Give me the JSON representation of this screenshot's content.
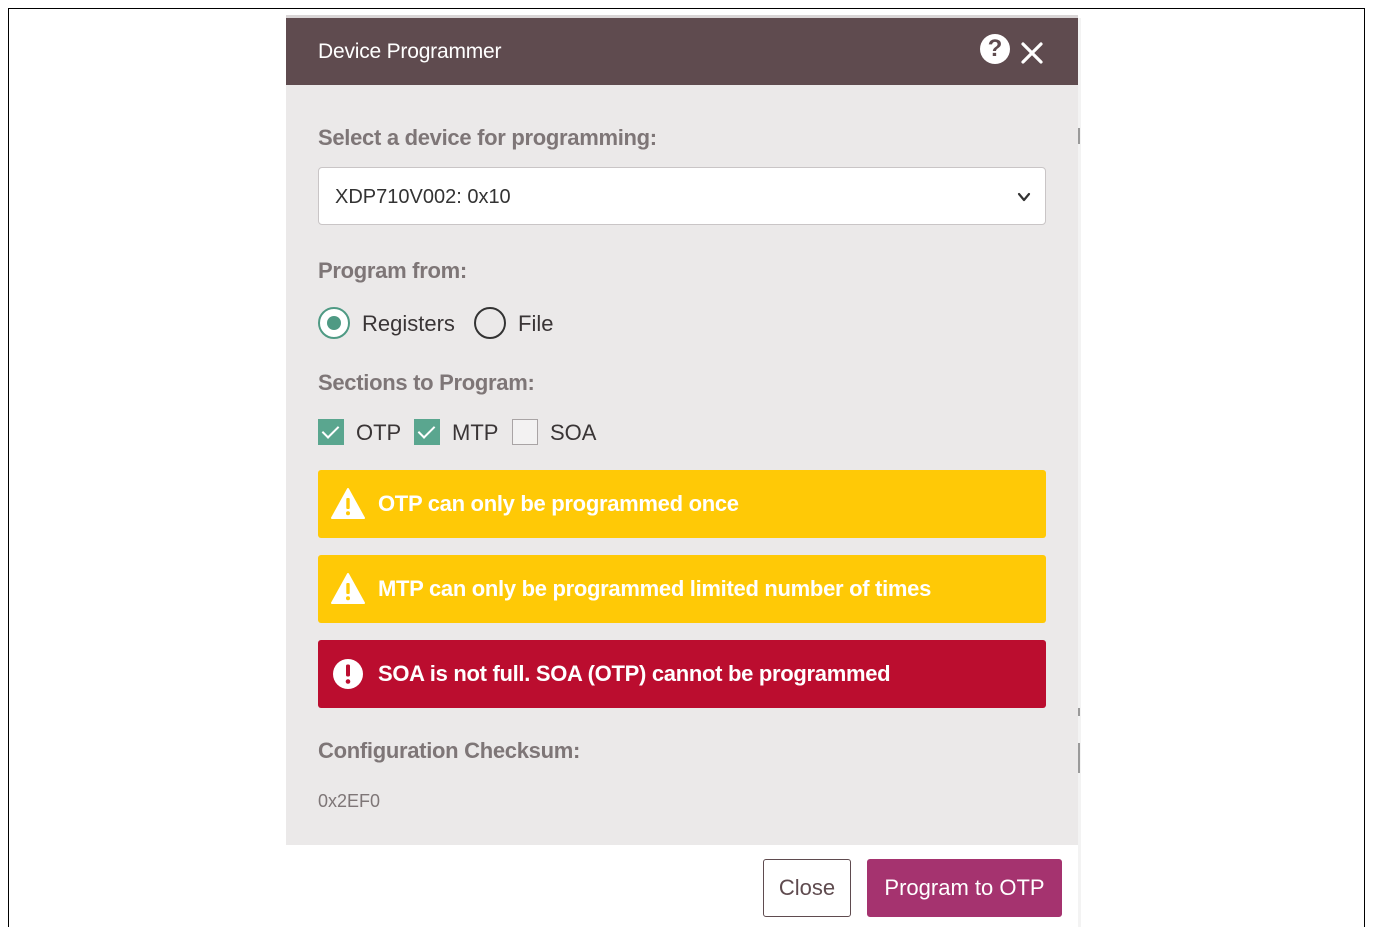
{
  "dialog": {
    "title": "Device Programmer",
    "help_icon_glyph": "?",
    "icons": [
      "help-icon",
      "close-icon"
    ]
  },
  "device_select": {
    "label": "Select a device for programming:",
    "value": "XDP710V002: 0x10"
  },
  "program_from": {
    "label": "Program from:",
    "options": [
      {
        "label": "Registers",
        "selected": true
      },
      {
        "label": "File",
        "selected": false
      }
    ]
  },
  "sections": {
    "label": "Sections to Program:",
    "items": [
      {
        "label": "OTP",
        "checked": true
      },
      {
        "label": "MTP",
        "checked": true
      },
      {
        "label": "SOA",
        "checked": false
      }
    ]
  },
  "alerts": [
    {
      "type": "warning",
      "icon": "warning-triangle-icon",
      "text": "OTP can only be programmed once"
    },
    {
      "type": "warning",
      "icon": "warning-triangle-icon",
      "text": "MTP can only be programmed limited number of times"
    },
    {
      "type": "error",
      "icon": "error-circle-icon",
      "text": "SOA is not full. SOA (OTP) cannot be programmed"
    }
  ],
  "checksum": {
    "label": "Configuration Checksum:",
    "value": "0x2EF0"
  },
  "footer": {
    "close_label": "Close",
    "program_label": "Program to OTP"
  },
  "colors": {
    "header": "#5f4b4f",
    "body": "#ebe9e9",
    "accent_green": "#4f9a84",
    "warning": "#ffc906",
    "error": "#bb0d2f",
    "primary_button": "#a5336f"
  }
}
